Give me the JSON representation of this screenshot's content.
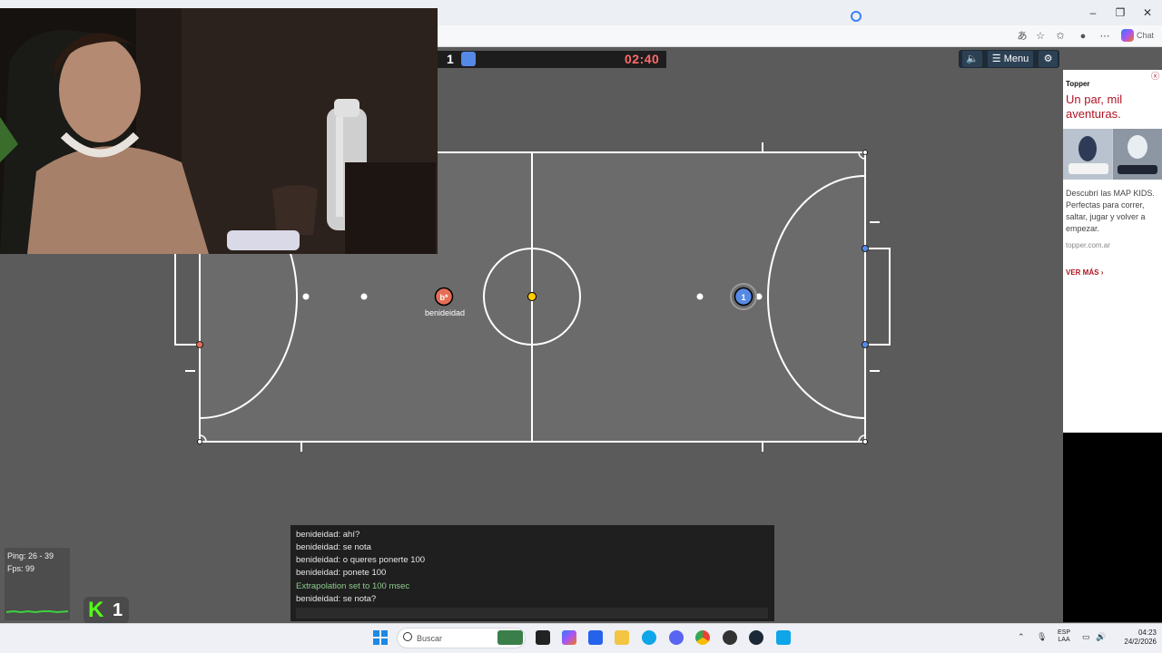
{
  "browser": {
    "chat_label": "Chat"
  },
  "game": {
    "score": "1",
    "timer": "02:40",
    "menu_label": "Menu",
    "player_red": {
      "name": "benideidad",
      "avatar": "b*"
    },
    "player_blue": {
      "avatar": "1"
    },
    "colors": {
      "red_team": "#e56e56",
      "blue_team": "#5689e5",
      "ball": "#ffcc00",
      "field_line": "#ffffff",
      "timer": "#ff6b6b"
    }
  },
  "ad": {
    "brand": "Topper",
    "headline": "Un par, mil aventuras.",
    "body": "Descubrí las MAP KIDS. Perfectas para correr, saltar, jugar y volver a empezar.",
    "url": "topper.com.ar",
    "cta": "VER MÁS"
  },
  "chat": {
    "messages": [
      {
        "text": "benideidad: ahí?",
        "type": "user"
      },
      {
        "text": "benideidad: se nota",
        "type": "user"
      },
      {
        "text": "benideidad: o queres ponerte 100",
        "type": "user"
      },
      {
        "text": "benideidad: ponete 100",
        "type": "user"
      },
      {
        "text": "Extrapolation set to 100 msec",
        "type": "system"
      },
      {
        "text": "benideidad: se nota?",
        "type": "user"
      }
    ]
  },
  "stats": {
    "ping": "Ping: 26 - 39",
    "fps": "Fps: 99"
  },
  "kick_badge": {
    "logo": "K",
    "count": "1"
  },
  "taskbar": {
    "search_label": "Buscar",
    "lang_1": "ESP",
    "lang_2": "LAA",
    "time": "04:23",
    "date": "24/2/2026"
  }
}
